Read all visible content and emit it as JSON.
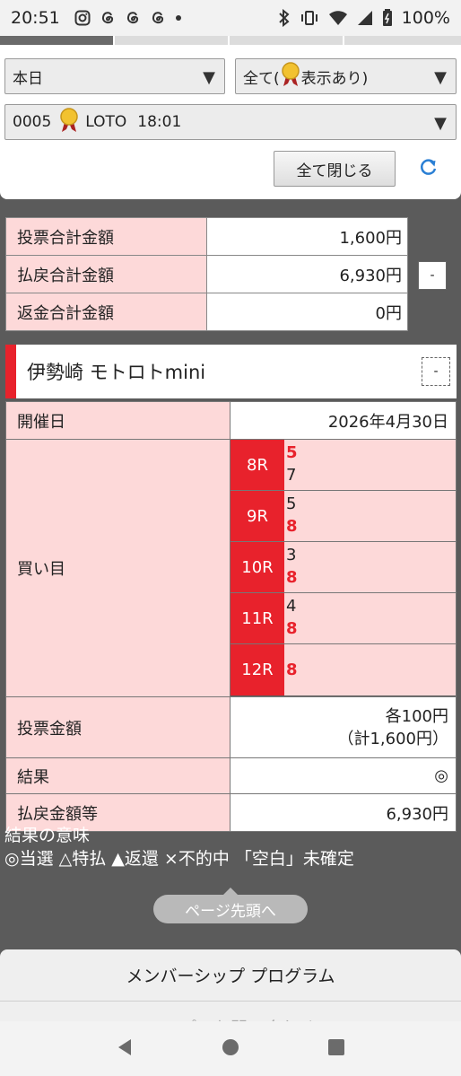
{
  "status_bar": {
    "time": "20:51",
    "battery": "100%"
  },
  "filters": {
    "date_select": "本日",
    "display_select_prefix": "全て(",
    "display_select_suffix": "表示あり)",
    "item_select_code": "0005",
    "item_select_name": "LOTO",
    "item_select_time": "18:01"
  },
  "actions": {
    "close_all": "全て閉じる",
    "collapse": "-"
  },
  "summary": [
    {
      "label": "投票合計金額",
      "value": "1,600円"
    },
    {
      "label": "払戻合計金額",
      "value": "6,930円"
    },
    {
      "label": "返金合計金額",
      "value": "0円"
    }
  ],
  "venue": {
    "name": "伊勢崎 モトロトmini"
  },
  "detail": {
    "date_label": "開催日",
    "date_value": "2026年4月30日",
    "picks_label": "買い目",
    "races": [
      {
        "race": "8R",
        "picks": [
          {
            "n": "5",
            "hit": true
          },
          {
            "n": "7",
            "hit": false
          }
        ]
      },
      {
        "race": "9R",
        "picks": [
          {
            "n": "5",
            "hit": false
          },
          {
            "n": "8",
            "hit": true
          }
        ]
      },
      {
        "race": "10R",
        "picks": [
          {
            "n": "3",
            "hit": false
          },
          {
            "n": "8",
            "hit": true
          }
        ]
      },
      {
        "race": "11R",
        "picks": [
          {
            "n": "4",
            "hit": false
          },
          {
            "n": "8",
            "hit": true
          }
        ]
      },
      {
        "race": "12R",
        "picks": [
          {
            "n": "8",
            "hit": true
          }
        ]
      }
    ],
    "bet_label": "投票金額",
    "bet_value_line1": "各100円",
    "bet_value_line2": "（計1,600円）",
    "result_label": "結果",
    "result_value": "◎",
    "payout_label": "払戻金額等",
    "payout_value": "6,930円"
  },
  "legend": {
    "title": "結果の意味",
    "text": "◎当選 △特払 ▲返還 ×不的中 「空白」未確定"
  },
  "to_top": "ページ先頭へ",
  "footer": {
    "item1": "メンバーシップ プログラム",
    "item2": "ヘルプ・お問い合わせ"
  },
  "colors": {
    "accent_red": "#e8222c",
    "header_pink": "#fdd9d9",
    "page_gray": "#5b5b5b"
  }
}
